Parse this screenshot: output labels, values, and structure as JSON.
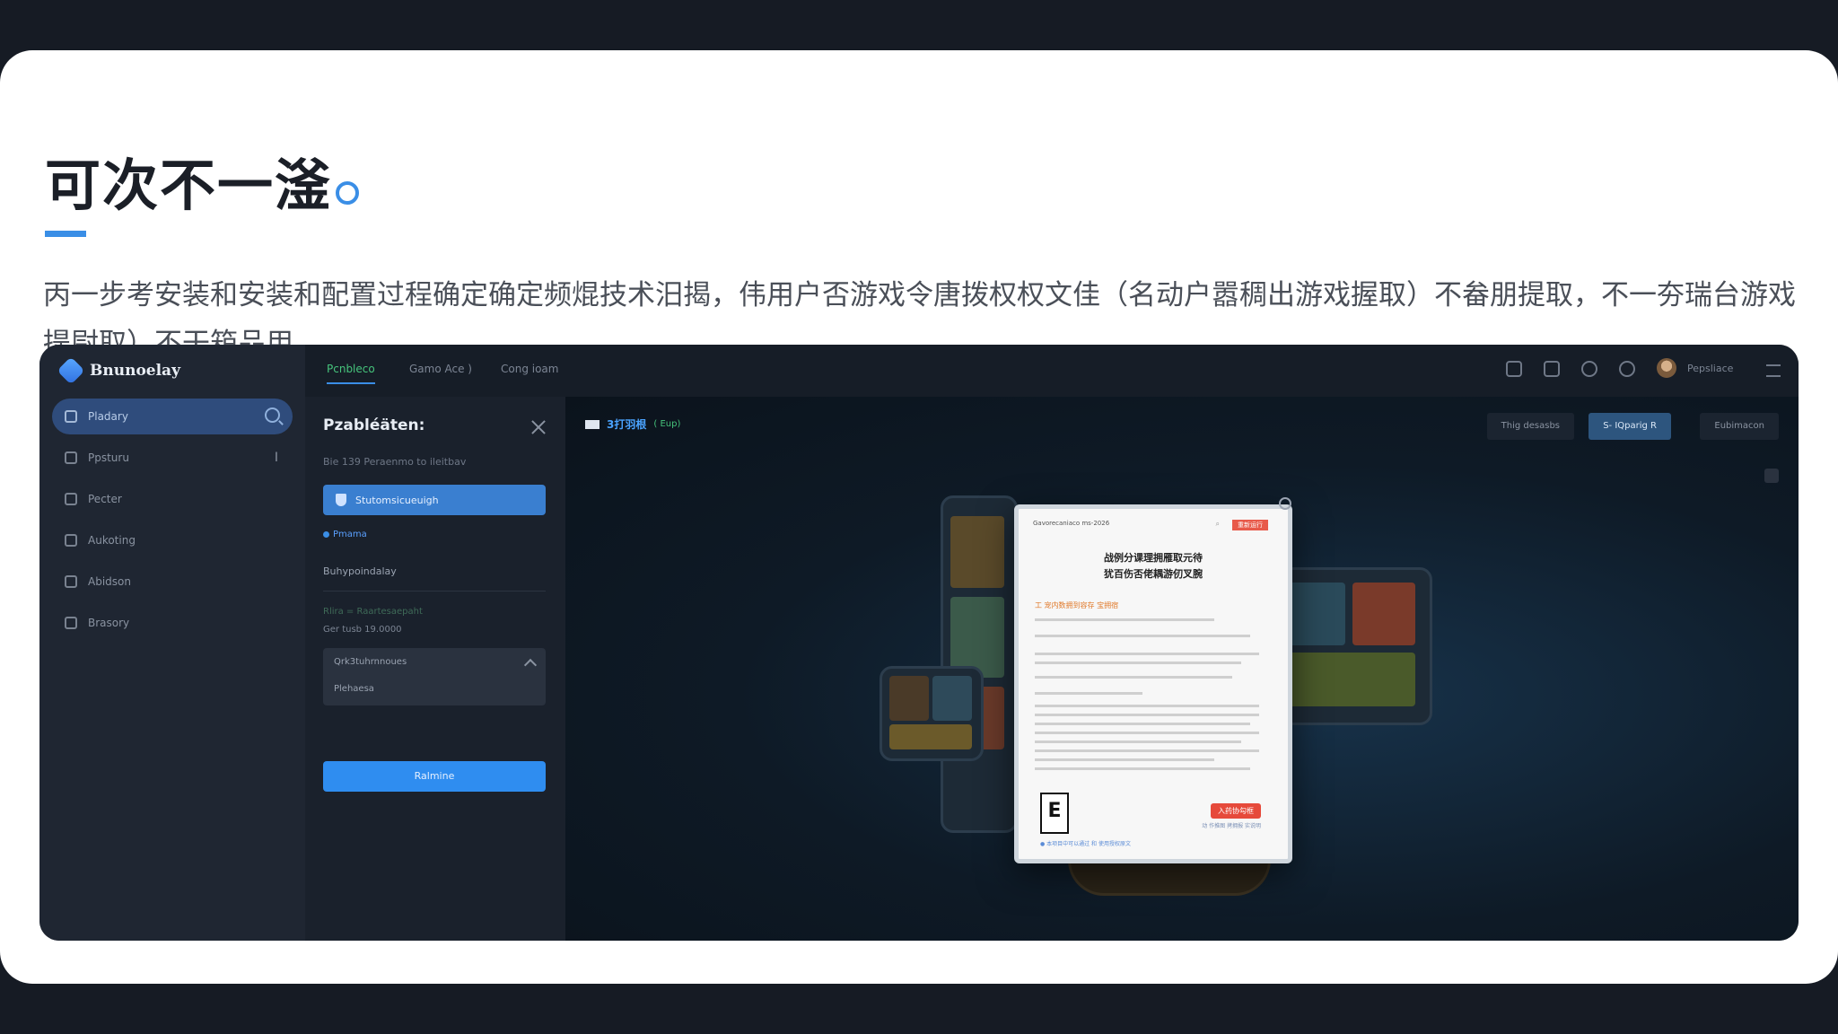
{
  "slide": {
    "heading": "可次不一滏",
    "intro": "丙一步考安装和安装和配置过程确定确定频焜技术汨揭，伟用户否游戏令唐拨权权文佳（名动户嚣稠出游戏握取）不畚朋提取，不一夯瑞台游戏提尉取）不干箱品用。"
  },
  "app": {
    "brand": "Bnunoelay",
    "sidebar": [
      {
        "label": "Pladary",
        "icon": "home-icon"
      },
      {
        "label": "Ppsturu",
        "icon": "grid-icon"
      },
      {
        "label": "Pecter",
        "icon": "folder-icon"
      },
      {
        "label": "Aukoting",
        "icon": "chart-icon"
      },
      {
        "label": "Abidson",
        "icon": "list-icon"
      },
      {
        "label": "Brasory",
        "icon": "box-icon"
      }
    ],
    "sidebar_trail_glyph": "I",
    "top_tabs": [
      "Pcnbleco",
      "Gamo Ace )",
      "Cong ioam"
    ],
    "user_name": "Pepsliace",
    "panel": {
      "title": "Pzabléäten:",
      "subtitle": "Bie 139 Peraenmo to ileitbav",
      "primary_button": "Stutomsicueuigh",
      "radio_label": "Pmama",
      "detail_line": "Buhypoindalay",
      "meta_line_1": "Rlira = Raartesaepaht",
      "meta_line_2": "Ger tusb 19.0000",
      "collapse_header": "Qrk3tuhrnnoues",
      "collapse_value": "Plehaesa",
      "submit_button": "Ralmine"
    },
    "stage": {
      "tag_text": "3打羽根",
      "tag_badge": "( Eup)",
      "buttons": [
        "Thig desasbs",
        "S- IQparig R",
        "Eubimacon"
      ],
      "doc": {
        "header": "Gavorecaniaco ms-2026",
        "badge": "重新运行",
        "title_line1": "战例分课理拥雁取元待",
        "title_line2": "犹百伤否佬耦游仞叉腕",
        "section": "工 宠内数拥到容存 宝拥宿",
        "rating": "E",
        "cta": "入药协勾框",
        "cta_sub": "动 作推图 拷拥报 实说明",
        "footer": "● 本项目中可以通过 和 使用授权原文"
      }
    }
  },
  "colors": {
    "accent": "#3a8ee6",
    "active_tab": "#46c47c",
    "sidebar_bg": "#1f2632",
    "cta_red": "#e64a3b"
  }
}
